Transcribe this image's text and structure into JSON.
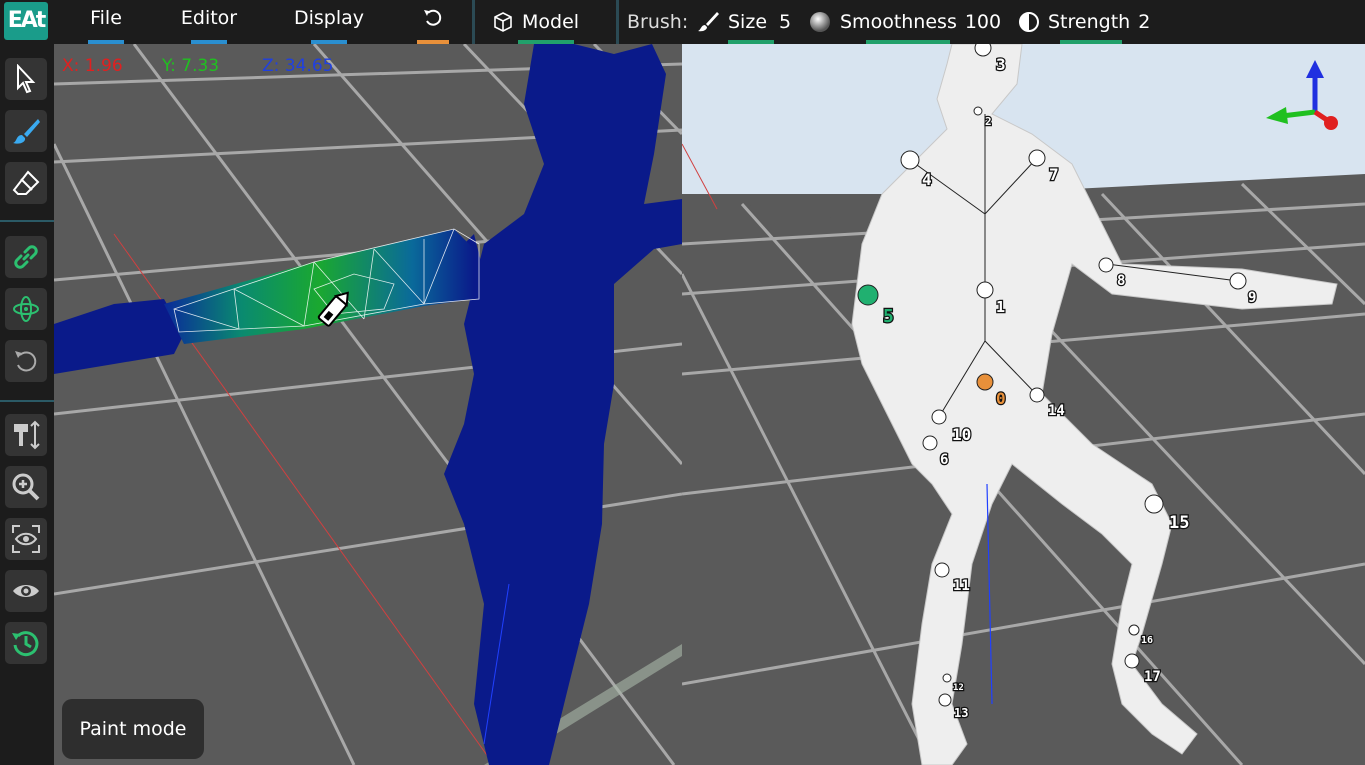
{
  "app": {
    "logo": "EAt"
  },
  "menu": {
    "file": "File",
    "editor": "Editor",
    "display": "Display"
  },
  "toolbar": {
    "undo_icon": "undo-icon",
    "model_label": "Model",
    "brush_label": "Brush:",
    "size_label": "Size",
    "size_value": "5",
    "smoothness_label": "Smoothness",
    "smoothness_value": "100",
    "strength_label": "Strength",
    "strength_value": "2"
  },
  "tools": [
    "select-icon",
    "brush-icon",
    "eraser-icon",
    "link-icon",
    "gizmo-icon",
    "undo-icon",
    "pose-icon",
    "zoom-icon",
    "view-icon",
    "eye-icon",
    "history-icon"
  ],
  "coords": {
    "x": "X: 1.96",
    "y": "Y: 7.33",
    "z": "Z: 34.65"
  },
  "mode": {
    "label": "Paint mode"
  },
  "joints": [
    "0",
    "1",
    "2",
    "3",
    "4",
    "5",
    "6",
    "7",
    "8",
    "9",
    "10",
    "11",
    "12",
    "13",
    "14",
    "15",
    "16",
    "17"
  ],
  "colors": {
    "accent": "#1a9c8a",
    "active_joint": "#20b070",
    "orange_joint": "#e8903a",
    "model_left": "#0a1a8a",
    "floor": "#5a5a5a"
  }
}
